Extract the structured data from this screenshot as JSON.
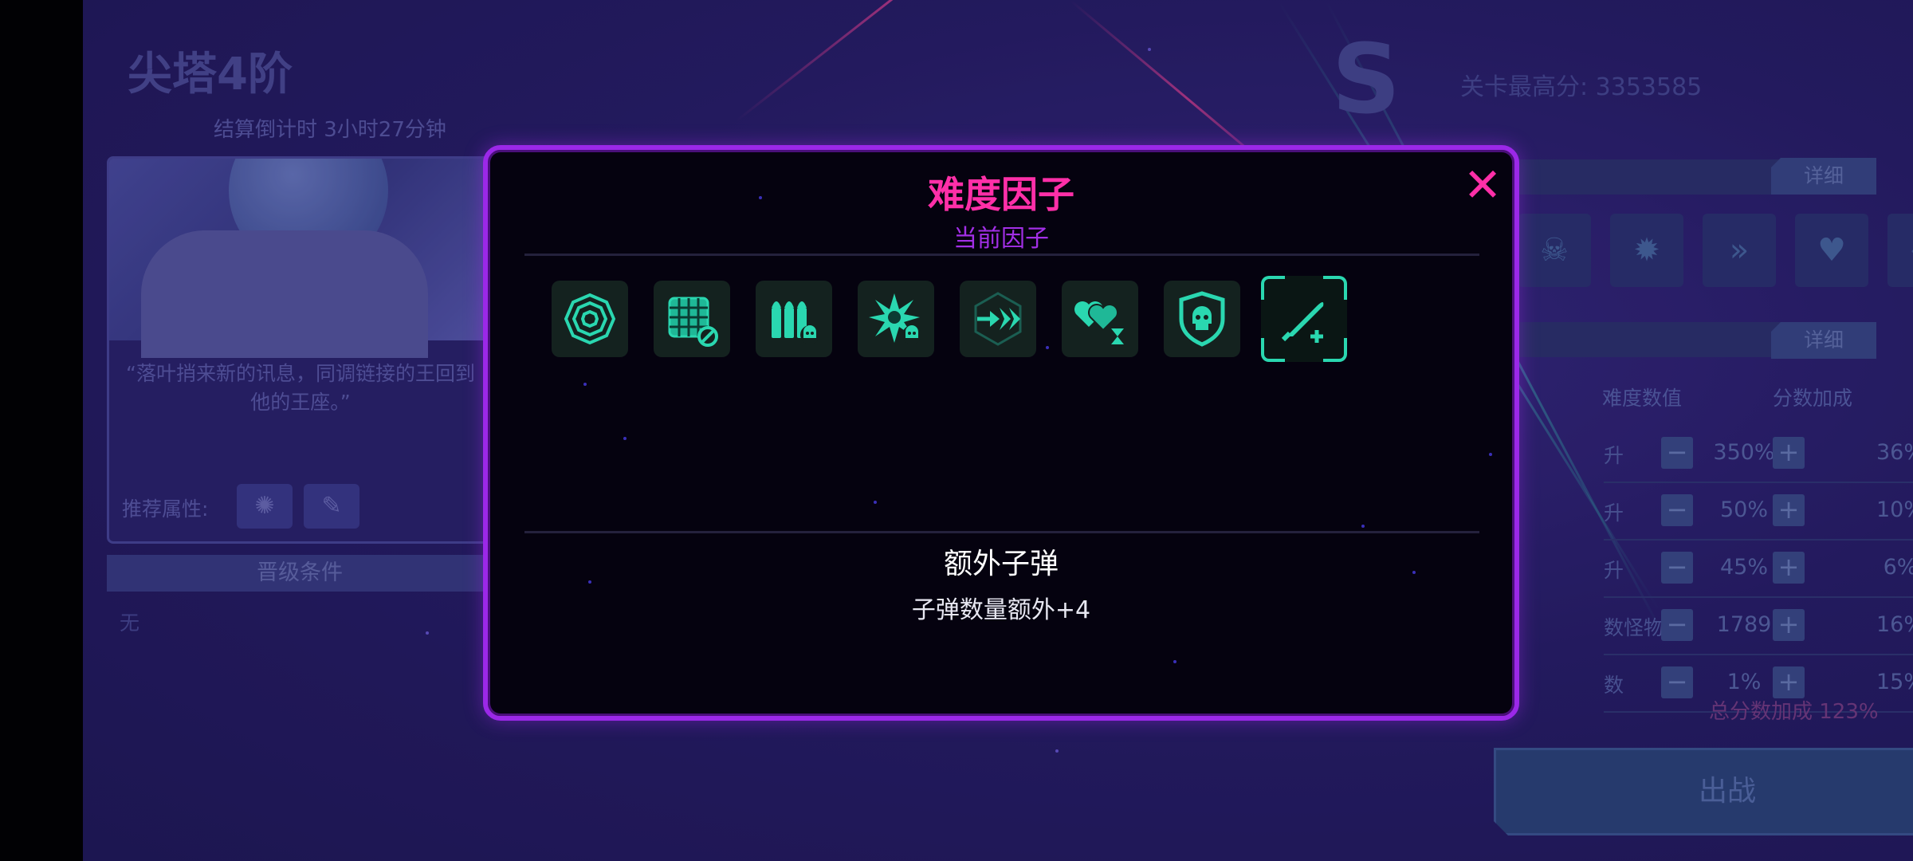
{
  "background": {
    "stage_title": "尖塔4阶",
    "countdown": "结算倒计时 3小时27分钟",
    "quote": "“落叶捎来新的讯息，同调链接的王回到他的王座。”",
    "recommended_label": "推荐属性:",
    "promotion_header": "晋级条件",
    "promotion_value": "无",
    "highscore": "关卡最高分: 3353585",
    "detail_label": "详细",
    "difficulty_header": "难度数值",
    "bonus_header": "分数加成",
    "rows": [
      {
        "label": "升",
        "value": "350%",
        "bonus": "36%"
      },
      {
        "label": "升",
        "value": "50%",
        "bonus": "10%"
      },
      {
        "label": "升",
        "value": "45%",
        "bonus": "6%"
      },
      {
        "label": "数怪物",
        "value": "1789",
        "bonus": "16%"
      },
      {
        "label": "数",
        "value": "1%",
        "bonus": "15%"
      }
    ],
    "total_bonus": "总分数加成 123%",
    "fight_button": "出战",
    "minus_sign": "−",
    "plus_sign": "+"
  },
  "modal": {
    "title": "难度因子",
    "subtitle": "当前因子",
    "close_symbol": "✕",
    "factors": [
      {
        "icon": "concentric-target-icon"
      },
      {
        "icon": "grid-block-icon"
      },
      {
        "icon": "bullets-skull-icon"
      },
      {
        "icon": "spiky-burst-skull-icon"
      },
      {
        "icon": "arrows-speed-icon"
      },
      {
        "icon": "hearts-timer-icon"
      },
      {
        "icon": "shield-skull-icon"
      },
      {
        "icon": "bullet-plus-icon",
        "selected": true
      }
    ],
    "selected_name": "额外子弹",
    "selected_desc": "子弹数量额外+4"
  },
  "colors": {
    "accent_pink": "#ff2fa8",
    "accent_purple": "#9b28e8",
    "icon_teal": "#2ad7b0"
  }
}
